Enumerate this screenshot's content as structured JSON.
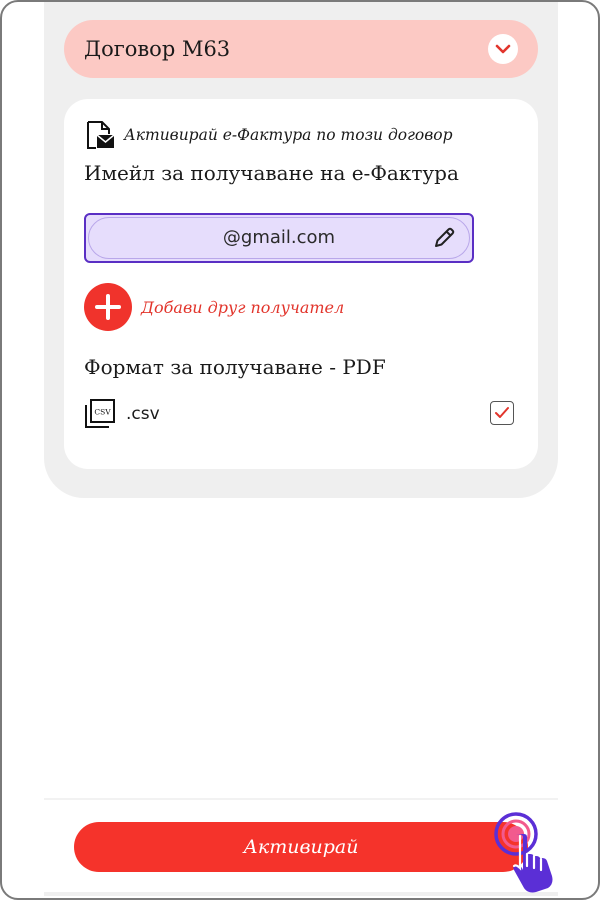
{
  "contract": {
    "title": "Договор М63"
  },
  "einvoice": {
    "activate_label": "Активирай е-Фактура по този договор",
    "email_heading": "Имейл за получаване на е-Фактура",
    "email_value": "@gmail.com",
    "add_recipient_label": "Добави друг получател",
    "format_heading": "Формат за получаване - PDF",
    "csv_label": ".csv",
    "csv_checked": true
  },
  "footer": {
    "activate_button_label": "Активирай"
  },
  "colors": {
    "brand_red": "#f5332b",
    "header_pink": "#fcc9c4",
    "field_purple": "#5a2fc4",
    "field_fill": "#e6ddfc",
    "cursor_purple": "#5b2fd6"
  },
  "icons": {
    "chevron": "chevron-down-icon",
    "email": "email-invoice-icon",
    "pencil": "pencil-icon",
    "plus": "plus-icon",
    "csv": "csv-file-icon",
    "check": "check-icon",
    "cursor": "hand-pointer-icon"
  }
}
